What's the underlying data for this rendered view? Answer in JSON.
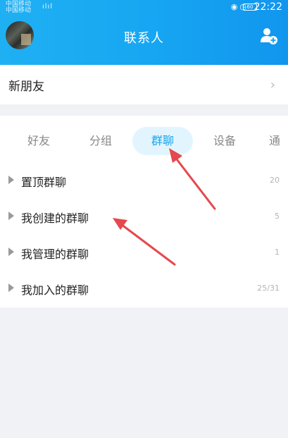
{
  "status_bar": {
    "carrier_1": "中国移动",
    "carrier_2": "中国移动",
    "signal": "ılıl",
    "battery": "60",
    "time": "22:22"
  },
  "header": {
    "title": "联系人",
    "avatar_icon": "avatar-pixelated",
    "add_icon": "add-contact-icon",
    "gradient": [
      "#1fb0f3",
      "#1196ee"
    ]
  },
  "new_friends": {
    "label": "新朋友",
    "chevron": "›"
  },
  "tabs": [
    {
      "label": "好友",
      "active": false
    },
    {
      "label": "分组",
      "active": false
    },
    {
      "label": "群聊",
      "active": true
    },
    {
      "label": "设备",
      "active": false
    },
    {
      "label": "通",
      "active": false
    }
  ],
  "groups": [
    {
      "label": "置顶群聊",
      "count": "20"
    },
    {
      "label": "我创建的群聊",
      "count": "5"
    },
    {
      "label": "我管理的群聊",
      "count": "1"
    },
    {
      "label": "我加入的群聊",
      "count": "25/31"
    }
  ],
  "colors": {
    "accent": "#16a4ee",
    "active_tab_bg": "#e2f5fe",
    "annotation_arrow": "#e5484d"
  }
}
